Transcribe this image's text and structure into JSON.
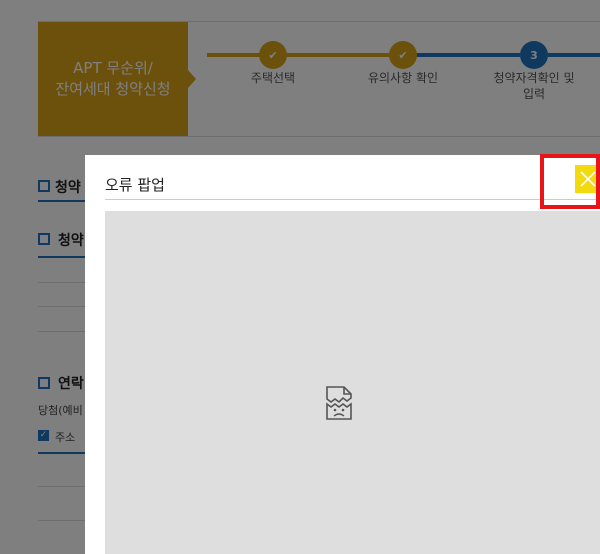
{
  "header": {
    "title": "APT 무순위/\n잔여세대 청약신청",
    "steps": [
      {
        "label": "주택선택",
        "status": "done",
        "mark": "✔"
      },
      {
        "label": "유의사항 확인",
        "status": "done",
        "mark": "✔"
      },
      {
        "label": "청약자격확인 및\n입력",
        "status": "current",
        "mark": "3"
      }
    ]
  },
  "background": {
    "section1": "청약",
    "section2": "청약",
    "section3": "연락",
    "note_text": "당첨(예비",
    "checkbox_label": "주소"
  },
  "modal": {
    "title": "오류 팝업",
    "frame_content": "broken-image-icon"
  },
  "colors": {
    "accent_gold": "#d9a21b",
    "step_blue": "#1e73be",
    "close_yellow": "#f3d90f",
    "highlight_red": "#e8141a"
  }
}
